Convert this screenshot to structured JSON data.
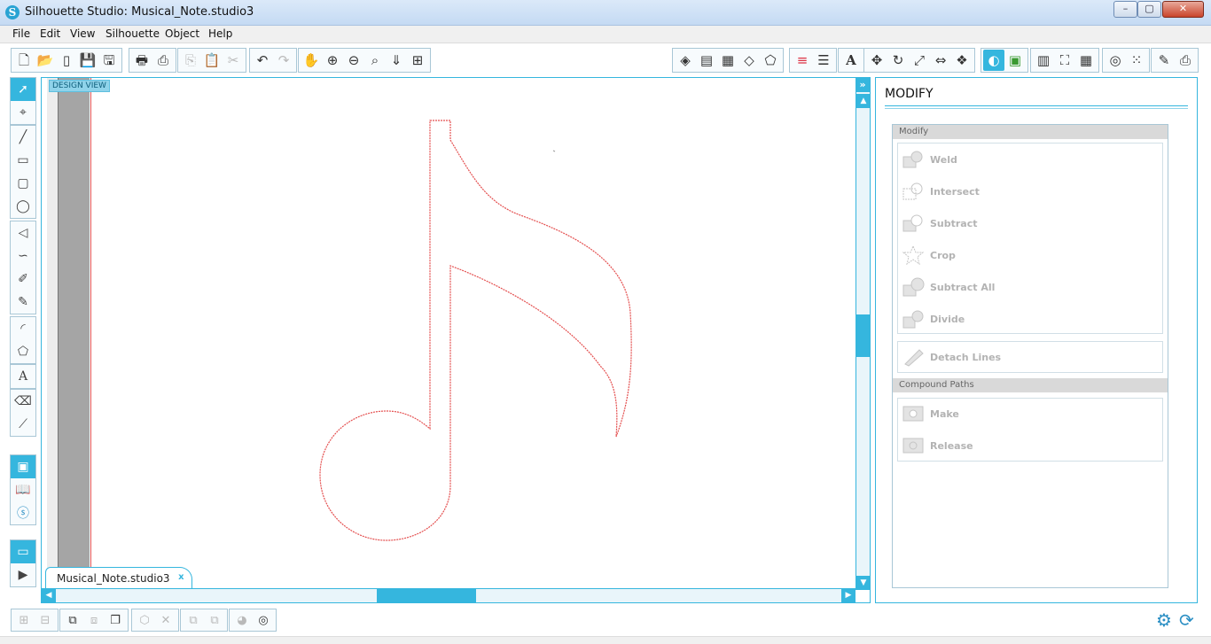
{
  "window": {
    "title": "Silhouette Studio: Musical_Note.studio3",
    "min": "–",
    "max": "▢",
    "close": "✕"
  },
  "menu": [
    "File",
    "Edit",
    "View",
    "Silhouette",
    "Object",
    "Help"
  ],
  "toolbar": {
    "groups": [
      {
        "icons": [
          "new-document-icon",
          "open-folder-icon",
          "sd-card-icon",
          "save-icon",
          "save-to-library-icon"
        ]
      },
      {
        "icons": [
          "print-icon",
          "print-cut-icon"
        ]
      },
      {
        "icons": [
          "copy-icon",
          "paste-icon",
          "cut-icon"
        ]
      },
      {
        "icons": [
          "undo-icon",
          "redo-icon"
        ]
      },
      {
        "icons": [
          "pan-hand-icon",
          "zoom-in-icon",
          "zoom-out-icon",
          "zoom-select-icon",
          "zoom-fit-icon",
          "zoom-page-icon"
        ]
      }
    ],
    "right_groups": [
      {
        "icons": [
          "fill-color-icon",
          "fill-gradient-icon",
          "fill-pattern-icon",
          "transparency-icon",
          "line-style-icon"
        ]
      },
      {
        "icons": [
          "line-color-icon",
          "line-style-icon-2"
        ]
      },
      {
        "icons": [
          "text-style-icon"
        ]
      },
      {
        "icons": [
          "align-icon",
          "rotate-icon",
          "scale-icon",
          "move-icon",
          "replicate-icon",
          "nesting-icon"
        ]
      },
      {
        "icons": [
          "modify-icon"
        ]
      },
      {
        "icons": [
          "offset-icon",
          "trace-icon",
          "grid-icon"
        ]
      },
      {
        "icons": [
          "spiral-icon",
          "rhinestone-icon"
        ]
      },
      {
        "icons": [
          "sketch-icon",
          "send-to-icon"
        ]
      }
    ]
  },
  "canvas": {
    "badge": "DESIGN VIEW",
    "tab_label": "Musical_Note.studio3",
    "tab_close": "x",
    "collapse": "»",
    "up": "▲",
    "down": "▼",
    "left": "◀",
    "right": "▶",
    "shape_color": "#e44f4f"
  },
  "panel": {
    "title": "MODIFY",
    "modify_header": "Modify",
    "items": [
      {
        "label": "Weld",
        "icon": "weld-icon"
      },
      {
        "label": "Intersect",
        "icon": "intersect-icon"
      },
      {
        "label": "Subtract",
        "icon": "subtract-icon"
      },
      {
        "label": "Crop",
        "icon": "crop-icon"
      },
      {
        "label": "Subtract All",
        "icon": "subtract-all-icon"
      },
      {
        "label": "Divide",
        "icon": "divide-icon"
      }
    ],
    "detach_label": "Detach Lines",
    "compound_header": "Compound Paths",
    "compound_items": [
      {
        "label": "Make",
        "icon": "make-compound-icon"
      },
      {
        "label": "Release",
        "icon": "release-compound-icon"
      }
    ]
  },
  "colors": {
    "accent": "#35b6de",
    "disabled_text": "#b3b3b3"
  }
}
